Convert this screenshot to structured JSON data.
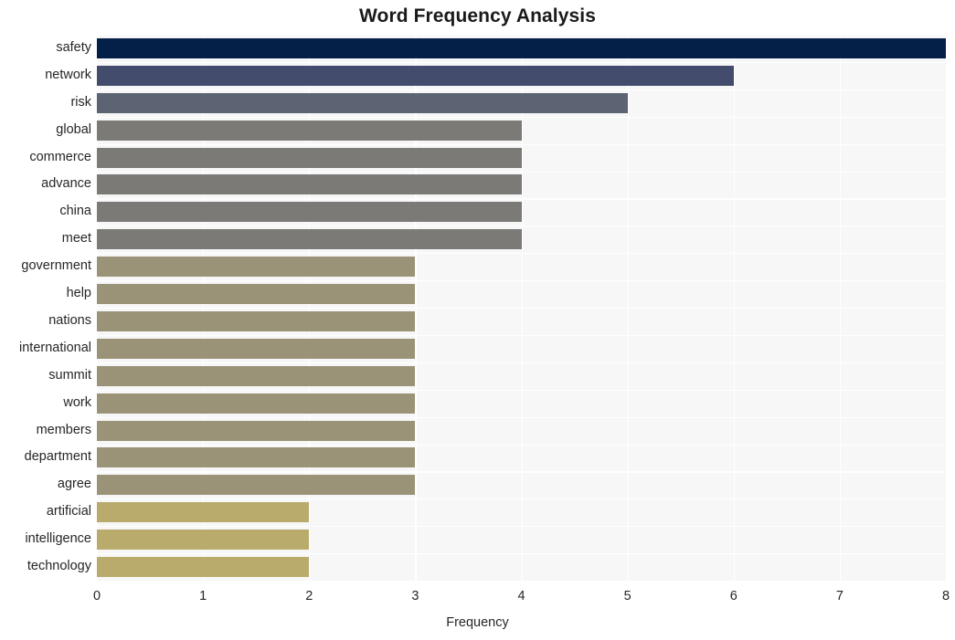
{
  "chart_data": {
    "type": "bar",
    "orientation": "horizontal",
    "title": "Word Frequency Analysis",
    "xlabel": "Frequency",
    "ylabel": "",
    "xlim": [
      0,
      8
    ],
    "xticks": [
      0,
      1,
      2,
      3,
      4,
      5,
      6,
      7,
      8
    ],
    "xtick_labels": [
      "0",
      "1",
      "2",
      "3",
      "4",
      "5",
      "6",
      "7",
      "8"
    ],
    "grid": true,
    "legend": false,
    "categories": [
      "safety",
      "network",
      "risk",
      "global",
      "commerce",
      "advance",
      "china",
      "meet",
      "government",
      "help",
      "nations",
      "international",
      "summit",
      "work",
      "members",
      "department",
      "agree",
      "artificial",
      "intelligence",
      "technology"
    ],
    "values": [
      8,
      6,
      5,
      4,
      4,
      4,
      4,
      4,
      3,
      3,
      3,
      3,
      3,
      3,
      3,
      3,
      3,
      2,
      2,
      2
    ],
    "bar_colors": [
      "#042049",
      "#434c6d",
      "#5c6372",
      "#7b7a77",
      "#7b7a77",
      "#7b7a77",
      "#7b7a77",
      "#7b7a77",
      "#9a9377",
      "#9a9377",
      "#9a9377",
      "#9a9377",
      "#9a9377",
      "#9a9377",
      "#9a9377",
      "#9a9377",
      "#9a9377",
      "#b8ab6b",
      "#b8ab6b",
      "#b8ab6b"
    ],
    "plot_background": "#f7f7f7",
    "figure_background": "#ffffff",
    "gridline_color": "#ffffff",
    "text_color": "#262626",
    "title_color": "#1a1a1a"
  }
}
